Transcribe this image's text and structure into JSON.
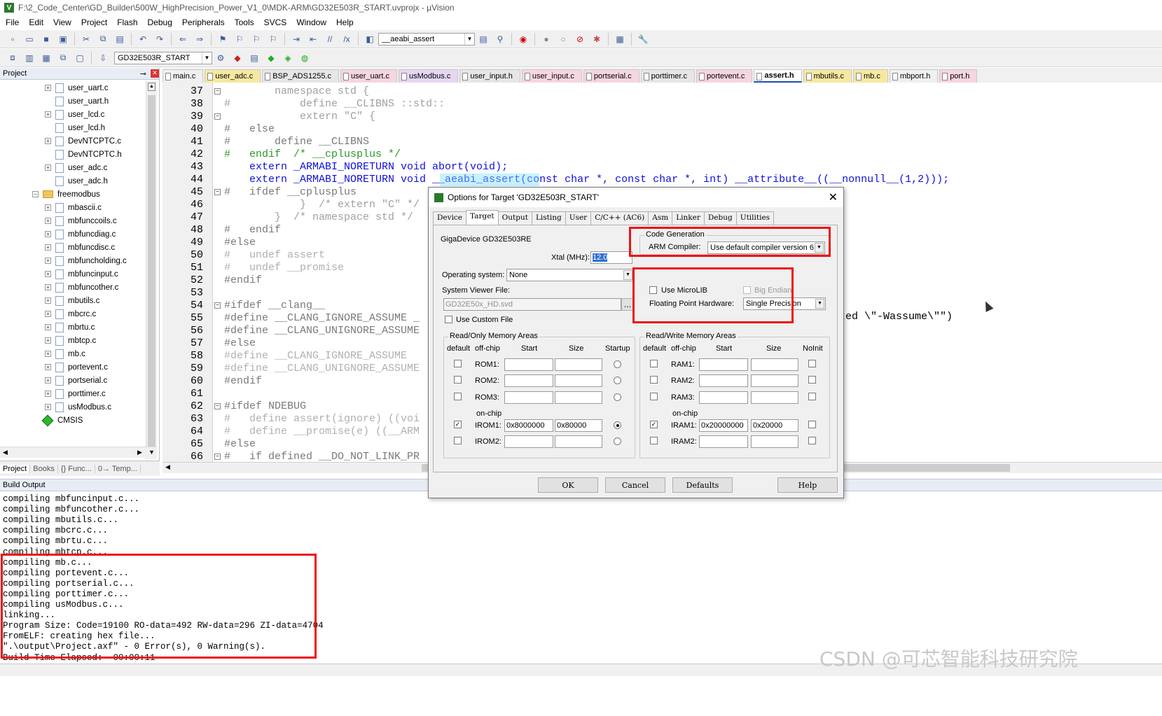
{
  "window": {
    "title": "F:\\2_Code_Center\\GD_Builder\\500W_HighPrecision_Power_V1_0\\MDK-ARM\\GD32E503R_START.uvprojx - µVision"
  },
  "menu": [
    "File",
    "Edit",
    "View",
    "Project",
    "Flash",
    "Debug",
    "Peripherals",
    "Tools",
    "SVCS",
    "Window",
    "Help"
  ],
  "toolbar": {
    "find_combo": "__aeabi_assert",
    "target_combo": "GD32E503R_START"
  },
  "project_panel": {
    "title": "Project",
    "items": [
      {
        "label": "user_uart.c",
        "exp": true
      },
      {
        "label": "user_uart.h",
        "exp": false
      },
      {
        "label": "user_lcd.c",
        "exp": true
      },
      {
        "label": "user_lcd.h",
        "exp": false
      },
      {
        "label": "DevNTCPTC.c",
        "exp": true
      },
      {
        "label": "DevNTCPTC.h",
        "exp": false
      },
      {
        "label": "user_adc.c",
        "exp": true
      },
      {
        "label": "user_adc.h",
        "exp": false
      }
    ],
    "folder": "freemodbus",
    "modbus_items": [
      "mbascii.c",
      "mbfunccoils.c",
      "mbfuncdiag.c",
      "mbfuncdisc.c",
      "mbfuncholding.c",
      "mbfuncinput.c",
      "mbfuncother.c",
      "mbutils.c",
      "mbcrc.c",
      "mbrtu.c",
      "mbtcp.c",
      "mb.c",
      "portevent.c",
      "portserial.c",
      "porttimer.c",
      "usModbus.c"
    ],
    "cmsis": "CMSIS",
    "tabs": [
      "Project",
      "Books",
      "{} Func...",
      "0→ Temp..."
    ]
  },
  "editor_tabs": [
    "main.c",
    "user_adc.c",
    "BSP_ADS1255.c",
    "user_uart.c",
    "usModbus.c",
    "user_input.h",
    "user_input.c",
    "portserial.c",
    "porttimer.c",
    "portevent.c",
    "assert.h",
    "mbutils.c",
    "mb.c",
    "mbport.h",
    "port.h"
  ],
  "active_tab": "assert.h",
  "code_lines": [
    {
      "n": "37",
      "t": "        namespace std {"
    },
    {
      "n": "38",
      "t": "#           define __CLIBNS ::std::"
    },
    {
      "n": "39",
      "t": "            extern \"C\" {"
    },
    {
      "n": "40",
      "t": "#   else"
    },
    {
      "n": "41",
      "t": "#       define __CLIBNS"
    },
    {
      "n": "42",
      "t": "#   endif  /* __cplusplus */"
    },
    {
      "n": "43",
      "t": "    extern _ARMABI_NORETURN void abort(void);"
    },
    {
      "n": "44",
      "t": "    extern _ARMABI_NORETURN void __aeabi_assert(const char *, const char *, int) __attribute__((__nonnull__(1,2)));"
    },
    {
      "n": "45",
      "t": "#   ifdef __cplusplus"
    },
    {
      "n": "46",
      "t": "            }  /* extern \"C\" */"
    },
    {
      "n": "47",
      "t": "        }  /* namespace std */"
    },
    {
      "n": "48",
      "t": "#   endif"
    },
    {
      "n": "49",
      "t": "#else"
    },
    {
      "n": "50",
      "t": "#   undef assert"
    },
    {
      "n": "51",
      "t": "#   undef __promise"
    },
    {
      "n": "52",
      "t": "#endif"
    },
    {
      "n": "53",
      "t": ""
    },
    {
      "n": "54",
      "t": "#ifdef __clang__"
    },
    {
      "n": "55",
      "t": "#define __CLANG_IGNORE_ASSUME _"
    },
    {
      "n": "56",
      "t": "#define __CLANG_UNIGNORE_ASSUME"
    },
    {
      "n": "57",
      "t": "#else"
    },
    {
      "n": "58",
      "t": "#define __CLANG_IGNORE_ASSUME"
    },
    {
      "n": "59",
      "t": "#define __CLANG_UNIGNORE_ASSUME"
    },
    {
      "n": "60",
      "t": "#endif"
    },
    {
      "n": "61",
      "t": ""
    },
    {
      "n": "62",
      "t": "#ifdef NDEBUG"
    },
    {
      "n": "63",
      "t": "#   define assert(ignore) ((voi"
    },
    {
      "n": "64",
      "t": "#   define __promise(e) ((__ARM"
    },
    {
      "n": "65",
      "t": "#else"
    },
    {
      "n": "66",
      "t": "#   if defined __DO_NOT_LINK_PR"
    }
  ],
  "code_fragment_56": "ted \\\"-Wassume\\\"\")",
  "build_output": {
    "title": "Build Output",
    "lines": [
      "compiling mbfuncinput.c...",
      "compiling mbfuncother.c...",
      "compiling mbutils.c...",
      "compiling mbcrc.c...",
      "compiling mbrtu.c...",
      "compiling mbtcp.c...",
      "compiling mb.c...",
      "compiling portevent.c...",
      "compiling portserial.c...",
      "compiling porttimer.c...",
      "compiling usModbus.c...",
      "linking...",
      "Program Size: Code=19100 RO-data=492 RW-data=296 ZI-data=4704",
      "FromELF: creating hex file...",
      "\".\\output\\Project.axf\" - 0 Error(s), 0 Warning(s).",
      "Build Time Elapsed:  00:00:11"
    ]
  },
  "dialog": {
    "title": "Options for Target 'GD32E503R_START'",
    "tabs": [
      "Device",
      "Target",
      "Output",
      "Listing",
      "User",
      "C/C++ (AC6)",
      "Asm",
      "Linker",
      "Debug",
      "Utilities"
    ],
    "active_tab": "Target",
    "device": "GigaDevice GD32E503RE",
    "xtal_label": "Xtal (MHz):",
    "xtal_value": "12.0",
    "os_label": "Operating system:",
    "os_value": "None",
    "svd_label": "System Viewer File:",
    "svd_value": "GD32E50x_HD.svd",
    "custom_file": "Use Custom File",
    "code_gen_title": "Code Generation",
    "arm_compiler_label": "ARM Compiler:",
    "arm_compiler_value": "Use default compiler version 6",
    "microlib": "Use MicroLIB",
    "big_endian": "Big Endian",
    "fp_label": "Floating Point Hardware:",
    "fp_value": "Single Precision",
    "ro_title": "Read/Only Memory Areas",
    "rw_title": "Read/Write Memory Areas",
    "ro_headers": {
      "default": "default",
      "offchip": "off-chip",
      "start": "Start",
      "size": "Size",
      "startup": "Startup"
    },
    "rw_headers": {
      "default": "default",
      "offchip": "off-chip",
      "start": "Start",
      "size": "Size",
      "noinit": "NoInit"
    },
    "onchip": "on-chip",
    "rom": [
      {
        "name": "ROM1:",
        "start": "",
        "size": ""
      },
      {
        "name": "ROM2:",
        "start": "",
        "size": ""
      },
      {
        "name": "ROM3:",
        "start": "",
        "size": ""
      },
      {
        "name": "IROM1:",
        "start": "0x8000000",
        "size": "0x80000"
      },
      {
        "name": "IROM2:",
        "start": "",
        "size": ""
      }
    ],
    "ram": [
      {
        "name": "RAM1:",
        "start": "",
        "size": ""
      },
      {
        "name": "RAM2:",
        "start": "",
        "size": ""
      },
      {
        "name": "RAM3:",
        "start": "",
        "size": ""
      },
      {
        "name": "IRAM1:",
        "start": "0x20000000",
        "size": "0x20000"
      },
      {
        "name": "IRAM2:",
        "start": "",
        "size": ""
      }
    ],
    "buttons": {
      "ok": "OK",
      "cancel": "Cancel",
      "defaults": "Defaults",
      "help": "Help"
    }
  },
  "watermark": "CSDN @可芯智能科技研究院",
  "colors": {
    "highlight": "#ee1111",
    "active_tab_accent": "#1a4fb0",
    "keyword": "#1010e0",
    "comment": "#2a9a2a"
  }
}
